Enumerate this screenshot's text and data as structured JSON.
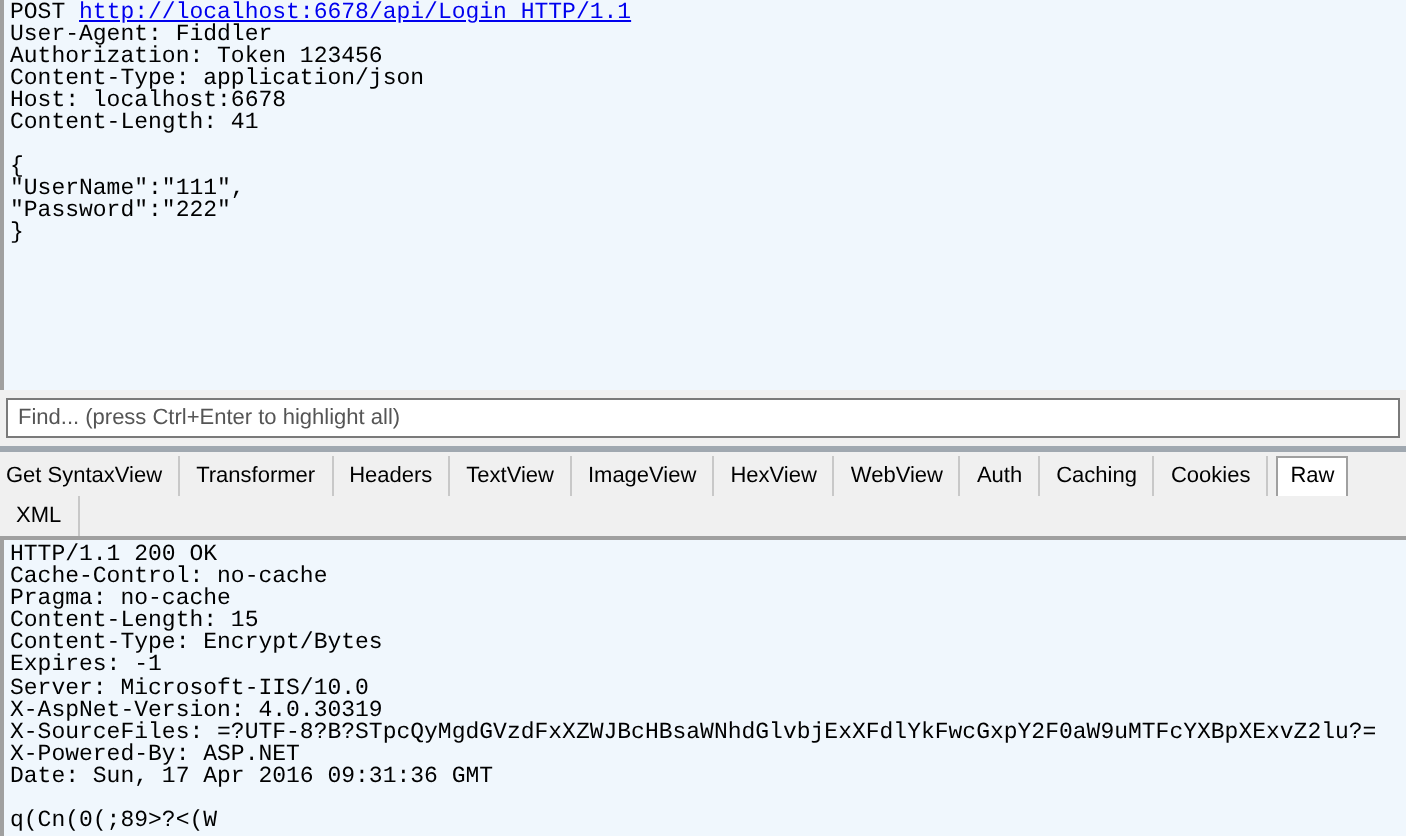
{
  "request": {
    "method": "POST",
    "url": "http://localhost:6678/api/Login HTTP/1.1",
    "headers": [
      "User-Agent: Fiddler",
      "Authorization: Token 123456",
      "Content-Type: application/json",
      "Host: localhost:6678",
      "Content-Length: 41"
    ],
    "body": [
      "{",
      "\"UserName\":\"111\",",
      "\"Password\":\"222\"",
      "}"
    ]
  },
  "find": {
    "placeholder": "Find... (press Ctrl+Enter to highlight all)"
  },
  "tabs": [
    {
      "label": "Get SyntaxView",
      "selected": false
    },
    {
      "label": "Transformer",
      "selected": false
    },
    {
      "label": "Headers",
      "selected": false
    },
    {
      "label": "TextView",
      "selected": false
    },
    {
      "label": "ImageView",
      "selected": false
    },
    {
      "label": "HexView",
      "selected": false
    },
    {
      "label": "WebView",
      "selected": false
    },
    {
      "label": "Auth",
      "selected": false
    },
    {
      "label": "Caching",
      "selected": false
    },
    {
      "label": "Cookies",
      "selected": false
    },
    {
      "label": "Raw",
      "selected": true
    },
    {
      "label": "XML",
      "selected": false
    }
  ],
  "response": {
    "headers": [
      "HTTP/1.1 200 OK",
      "Cache-Control: no-cache",
      "Pragma: no-cache",
      "Content-Length: 15",
      "Content-Type: Encrypt/Bytes",
      "Expires: -1",
      "Server: Microsoft-IIS/10.0",
      "X-AspNet-Version: 4.0.30319",
      "X-SourceFiles: =?UTF-8?B?STpcQyMgdGVzdFxXZWJBcHBsaWNhdGlvbjExXFdlYkFwcGxpY2F0aW9uMTFcYXBpXExvZ2lu?=",
      "X-Powered-By: ASP.NET",
      "Date: Sun, 17 Apr 2016 09:31:36 GMT"
    ],
    "body": [
      "q(Cn(0(;89>?<(W"
    ]
  }
}
